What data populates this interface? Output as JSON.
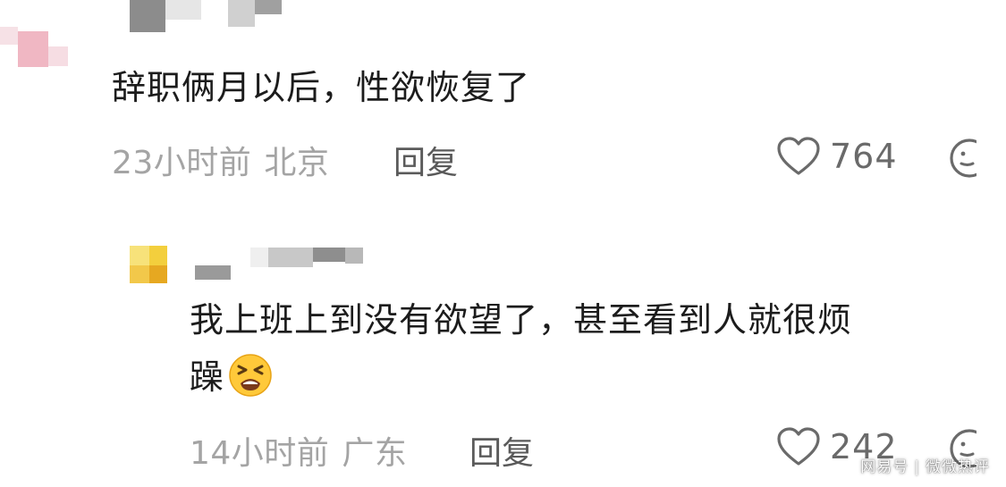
{
  "comment1": {
    "text": "辞职俩月以后，性欲恢复了",
    "time": "23小时前",
    "location": "北京",
    "reply_label": "回复",
    "likes": "764"
  },
  "comment2": {
    "text_line1": "我上班上到没有欲望了，甚至看到人就很烦",
    "text_line2": "躁",
    "emoji": "tired-face-emoji",
    "time": "14小时前",
    "location": "广东",
    "reply_label": "回复",
    "likes": "242"
  },
  "watermark": {
    "source": "网易号",
    "separator": "|",
    "account": "微微热评"
  },
  "icons": {
    "like": "heart-icon",
    "comment": "comment-icon"
  }
}
